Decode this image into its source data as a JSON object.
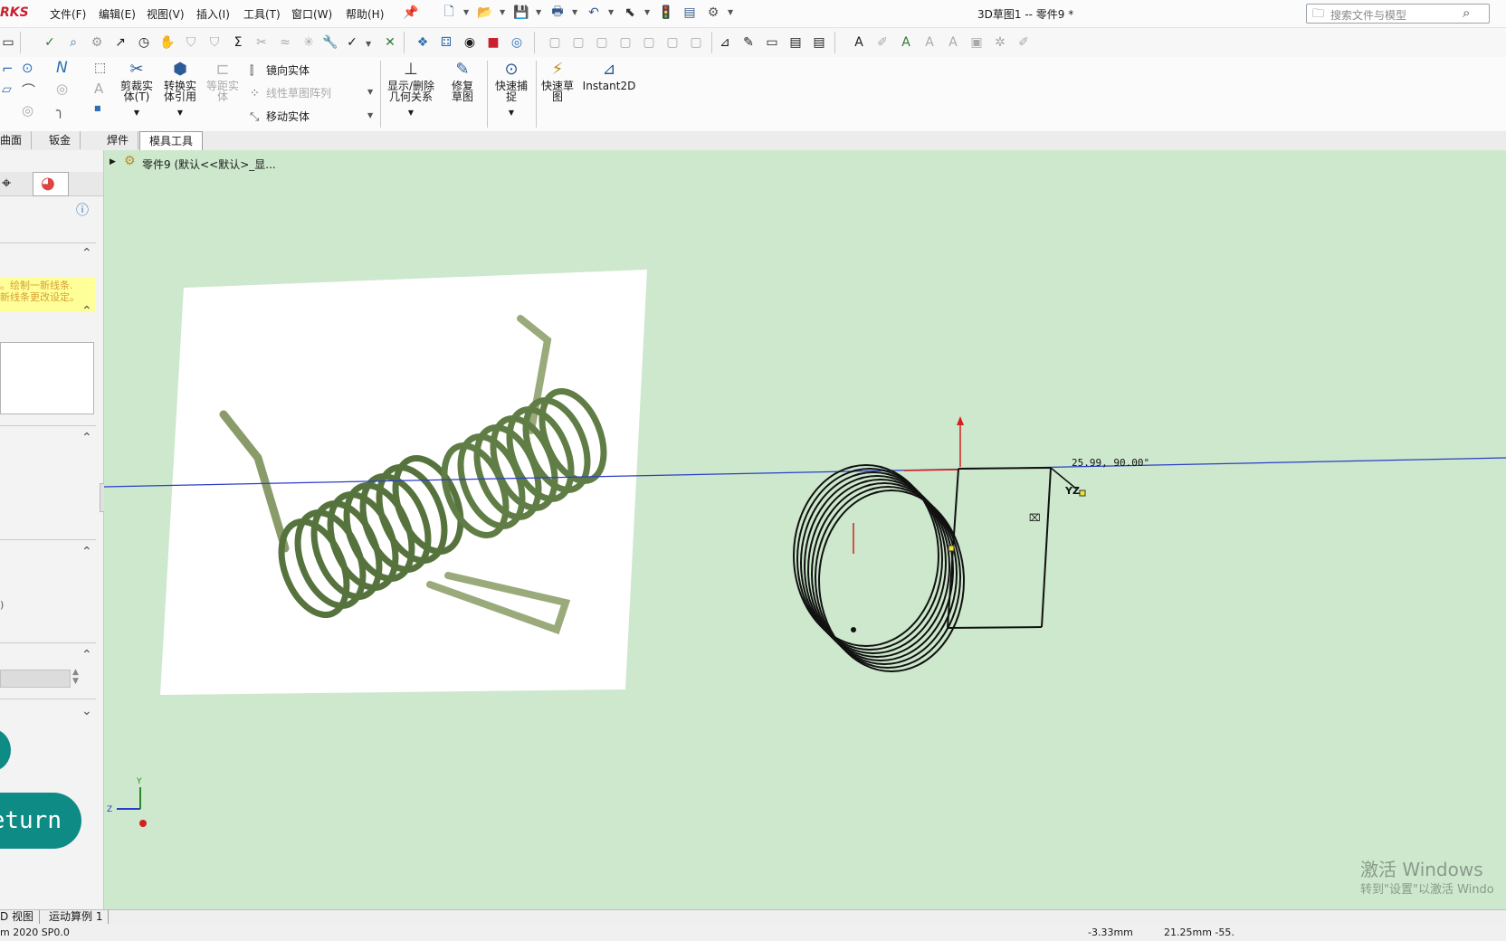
{
  "app": {
    "brand": "RKS",
    "document_title": "3D草图1 -- 零件9 *"
  },
  "menu": [
    "文件(F)",
    "编辑(E)",
    "视图(V)",
    "插入(I)",
    "工具(T)",
    "窗口(W)",
    "帮助(H)"
  ],
  "search": {
    "placeholder": "搜索文件与模型"
  },
  "commands": {
    "trim": "剪裁实体(T)",
    "convert": "转换实体引用",
    "offset": "等距实体",
    "mirror": "镜向实体",
    "linear_pattern": "线性草图阵列",
    "move": "移动实体",
    "display_relations": "显示/删除几何关系",
    "repair": "修复草图",
    "quick_snaps": "快速捕捉",
    "rapid_sketch": "快速草图",
    "instant2d": "Instant2D"
  },
  "tabs": [
    "曲面",
    "钣金",
    "焊件",
    "模具工具"
  ],
  "feature_tree": {
    "item": "零件9 (默认<<默认>_显..."
  },
  "left_panel": {
    "message_line1": "。绘制一新线条.",
    "message_line2": "新线条更改设定。",
    "truncated_label": ")",
    "return_label": "eturn"
  },
  "sketch": {
    "dimension_readout": "25.99, 90.00°",
    "plane_label": "YZ"
  },
  "triad": {
    "y": "Y",
    "z": "Z"
  },
  "bottom_tabs": [
    "D 视图",
    "运动算例 1"
  ],
  "status": {
    "version": "m 2020 SP0.0",
    "coord_x": "-3.33mm",
    "coord_y": "21.25mm -55."
  },
  "watermark": {
    "line1": "激活 Windows",
    "line2": "转到\"设置\"以激活 Windo"
  },
  "colors": {
    "viewport": "#cde8cd",
    "accent_teal": "#0f8b86",
    "brand_red": "#c8202f"
  }
}
